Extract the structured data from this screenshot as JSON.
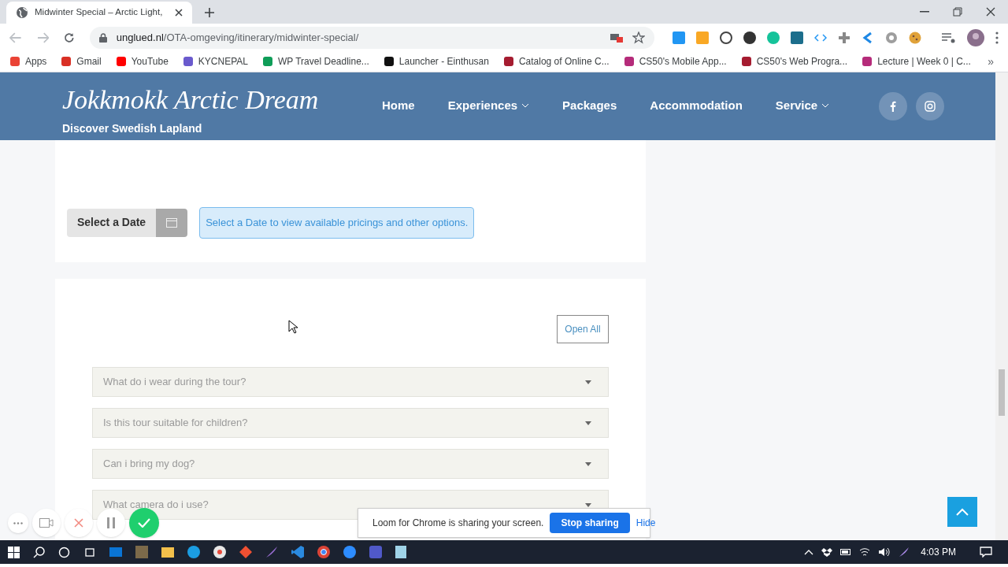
{
  "browser": {
    "tab_title": "Midwinter Special – Arctic Light,",
    "url_host": "unglued.nl",
    "url_path": "/OTA-omgeving/itinerary/midwinter-special/",
    "bookmarks": [
      {
        "label": "Apps",
        "color": "#ea4335"
      },
      {
        "label": "Gmail",
        "color": "#d93025"
      },
      {
        "label": "YouTube",
        "color": "#ff0000"
      },
      {
        "label": "KYCNEPAL",
        "color": "#6a5acd"
      },
      {
        "label": "WP Travel Deadline...",
        "color": "#0f9d58"
      },
      {
        "label": "Launcher - Einthusan",
        "color": "#111111"
      },
      {
        "label": "Catalog of Online C...",
        "color": "#a51c30"
      },
      {
        "label": "CS50's Mobile App...",
        "color": "#b52b7a"
      },
      {
        "label": "CS50's Web Progra...",
        "color": "#a51c30"
      },
      {
        "label": "Lecture | Week 0 | C...",
        "color": "#b52b7a"
      }
    ],
    "overflow": "»"
  },
  "header": {
    "logo": "Jokkmokk Arctic Dream",
    "tagline": "Discover Swedish Lapland",
    "nav": [
      {
        "label": "Home",
        "dropdown": false
      },
      {
        "label": "Experiences",
        "dropdown": true
      },
      {
        "label": "Packages",
        "dropdown": false
      },
      {
        "label": "Accommodation",
        "dropdown": false
      },
      {
        "label": "Service",
        "dropdown": true
      }
    ]
  },
  "booking": {
    "select_date": "Select a Date",
    "notice": "Select a Date to view available pricings and other options."
  },
  "faq": {
    "open_all": "Open All",
    "items": [
      {
        "question": "What do i wear during the tour?",
        "expanded": false
      },
      {
        "question": "Is this tour suitable for children?",
        "expanded": false
      },
      {
        "question": "Can i bring my dog?",
        "expanded": false
      },
      {
        "question": "What camera do i use?",
        "expanded": false
      }
    ]
  },
  "loom": {
    "message": "Loom for Chrome is sharing your screen.",
    "stop": "Stop sharing",
    "hide": "Hide"
  },
  "taskbar": {
    "time": "4:03 PM"
  }
}
